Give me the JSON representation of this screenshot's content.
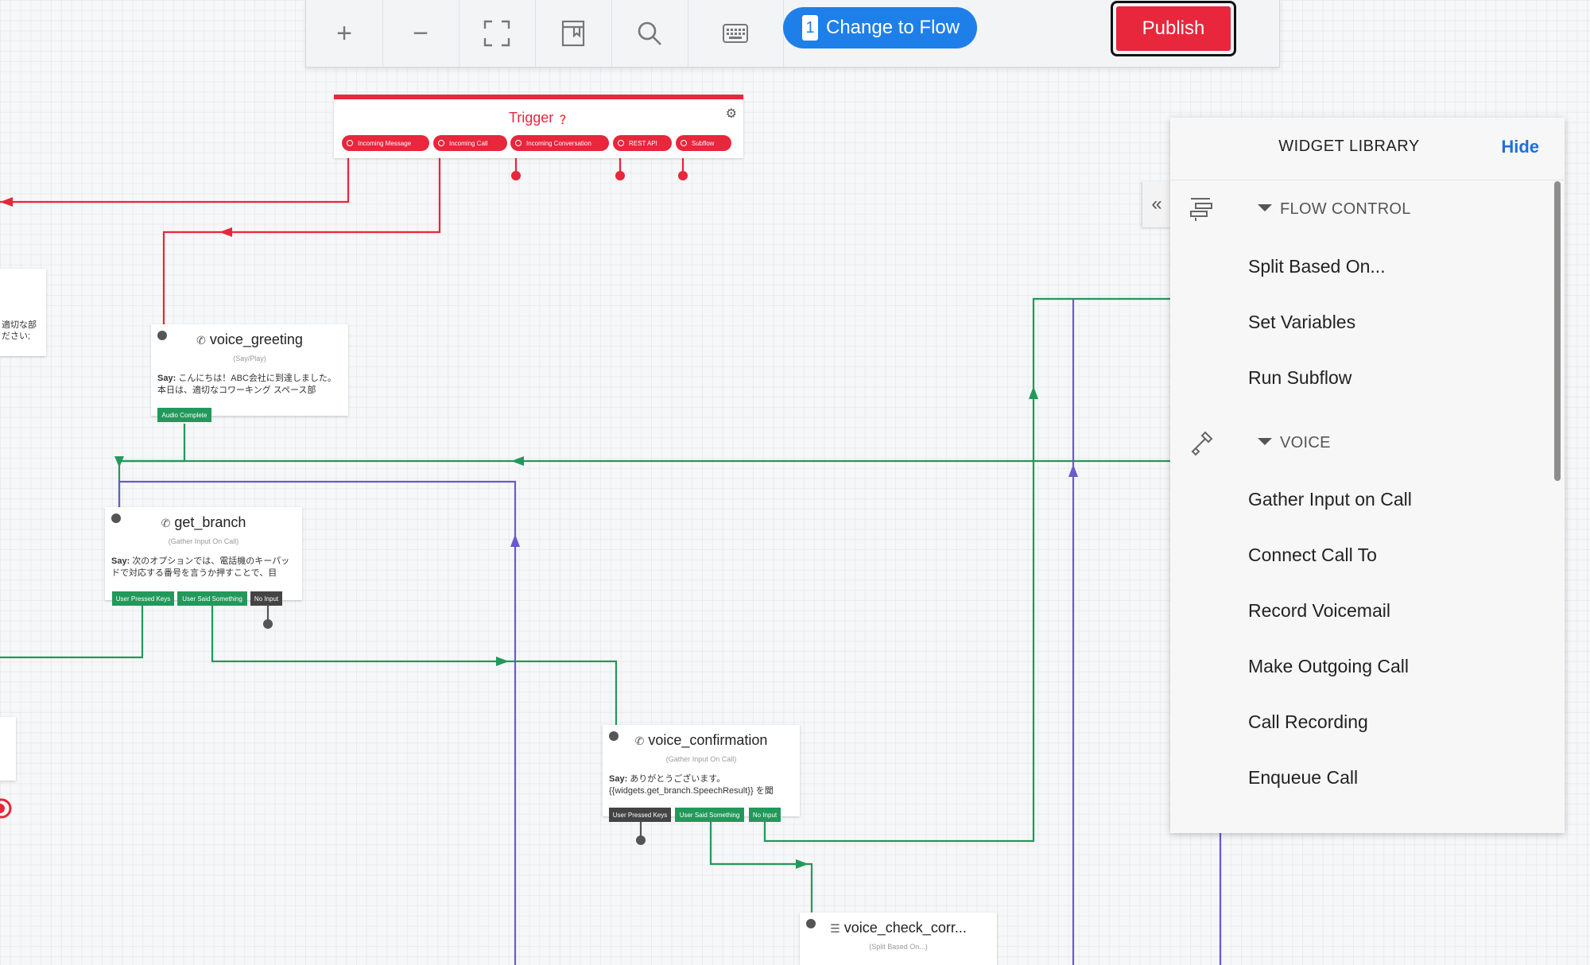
{
  "toolbar": {
    "zoom_in": "+",
    "zoom_out": "−",
    "change_flow_count": "1",
    "change_flow_label": "Change to Flow",
    "publish_label": "Publish"
  },
  "trigger": {
    "title": "Trigger",
    "pills": [
      "Incoming Message",
      "Incoming Call",
      "Incoming Conversation",
      "REST API",
      "Subflow"
    ]
  },
  "widgets": {
    "voice_greeting": {
      "name": "voice_greeting",
      "type": "(Say/Play)",
      "say_label": "Say:",
      "body": "こんにちは！ABC会社に到達しました。本日は、適切なコワーキング スペース部",
      "ports": [
        "Audio Complete"
      ]
    },
    "get_branch": {
      "name": "get_branch",
      "type": "(Gather Input On Call)",
      "say_label": "Say:",
      "body": "次のオプションでは、電話機のキーパッドで対応する番号を言うか押すことで、目",
      "ports": [
        "User Pressed Keys",
        "User Said Something",
        "No Input"
      ]
    },
    "voice_confirmation": {
      "name": "voice_confirmation",
      "type": "(Gather Input On Call)",
      "say_label": "Say:",
      "body": "ありがとうございます。{{widgets.get_branch.SpeechResult}} を聞",
      "ports": [
        "User Pressed Keys",
        "User Said Something",
        "No Input"
      ]
    },
    "voice_check": {
      "name": "voice_check_corr...",
      "type": "(Split Based On...)"
    },
    "partial_left": {
      "line1": "適切な部",
      "line2": "ださい;"
    }
  },
  "library": {
    "title": "WIDGET LIBRARY",
    "hide_label": "Hide",
    "categories": [
      {
        "name": "FLOW CONTROL",
        "icon": "flow-control-icon",
        "items": [
          "Split Based On...",
          "Set Variables",
          "Run Subflow"
        ]
      },
      {
        "name": "VOICE",
        "icon": "phone-icon",
        "items": [
          "Gather Input on Call",
          "Connect Call To",
          "Record Voicemail",
          "Make Outgoing Call",
          "Call Recording",
          "Enqueue Call"
        ]
      }
    ]
  },
  "colors": {
    "red": "#e8263c",
    "green": "#22995b",
    "purple": "#6a5acd",
    "blue": "#1f7fe8"
  }
}
